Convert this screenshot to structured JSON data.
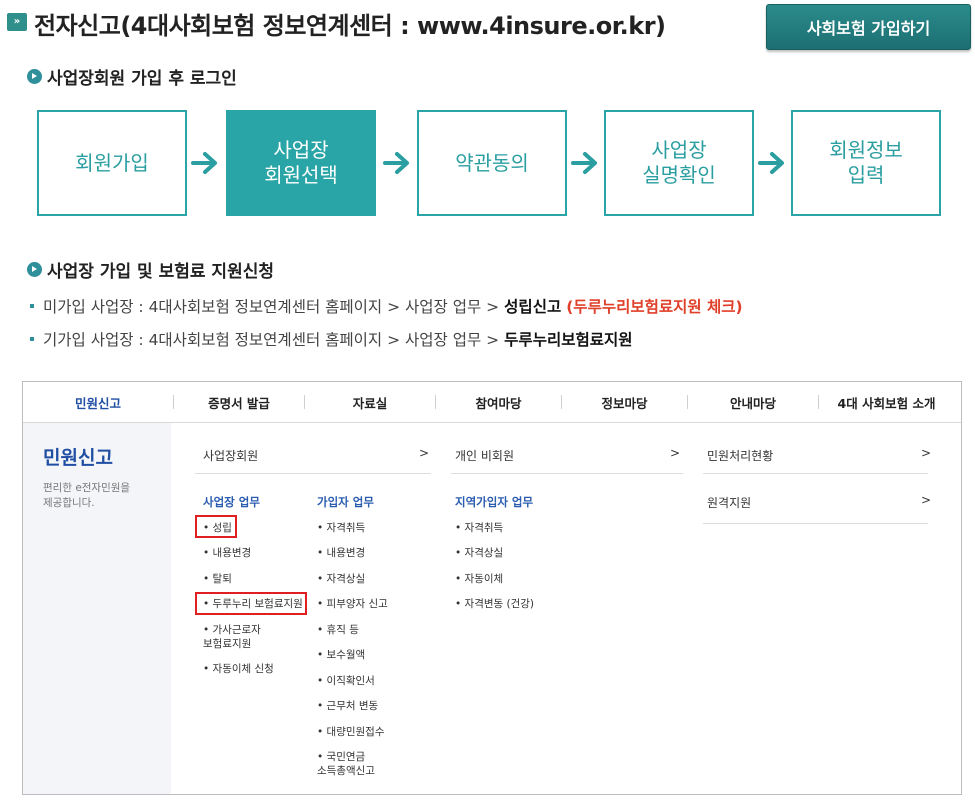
{
  "header": {
    "icon": "double-chevron-right-icon",
    "title": "전자신고(4대사회보험 정보연계센터 : www.4insure.or.kr)",
    "join_button": "사회보험 가입하기"
  },
  "section1": {
    "heading": "사업장회원 가입 후 로그인",
    "steps": [
      {
        "label": "회원가입",
        "active": false
      },
      {
        "label": "사업장\n회원선택",
        "active": true
      },
      {
        "label": "약관동의",
        "active": false
      },
      {
        "label": "사업장\n실명확인",
        "active": false
      },
      {
        "label": "회원정보\n입력",
        "active": false
      }
    ]
  },
  "section2": {
    "heading": "사업장 가입 및 보험료 지원신청",
    "line1": {
      "prefix": "미가입 사업장 : 4대사회보험 정보연계센터 홈페이지 > 사업장 업무 >",
      "bold": "성립신고",
      "red": "(두루누리보험료지원 체크)"
    },
    "line2": {
      "prefix": "기가입 사업장 : 4대사회보험 정보연계센터 홈페이지 > 사업장 업무 >",
      "bold": "두루누리보험료지원"
    }
  },
  "screenshot": {
    "nav": [
      "민원신고",
      "증명서 발급",
      "자료실",
      "참여마당",
      "정보마당",
      "안내마당",
      "4대 사회보험 소개"
    ],
    "left_title": "민원신고",
    "left_desc": "편리한 e전자민원을\n제공합니다.",
    "menu": {
      "biz_member": "사업장회원",
      "personal_member": "개인 비회원",
      "status": "민원처리현황",
      "remote": "원격지원",
      "chevron": ">"
    },
    "col_biz": {
      "head": "사업장 업무",
      "items": [
        "성립",
        "내용변경",
        "탈퇴",
        "두루누리 보험료지원",
        "가사근로자\n보험료지원",
        "자동이체 신청"
      ]
    },
    "col_sub": {
      "head": "가입자 업무",
      "items": [
        "자격취득",
        "내용변경",
        "자격상실",
        "피부양자 신고",
        "휴직 등",
        "보수월액",
        "이직확인서",
        "근무처 변동",
        "대량민원접수",
        "국민연금\n소득총액신고"
      ]
    },
    "col_region": {
      "head": "지역가입자 업무",
      "items": [
        "자격취득",
        "자격상실",
        "자동이체",
        "자격변동 (건강)"
      ]
    }
  },
  "colors": {
    "teal": "#2aa5a7",
    "red": "#e0402a",
    "blue": "#1f4ea3"
  }
}
